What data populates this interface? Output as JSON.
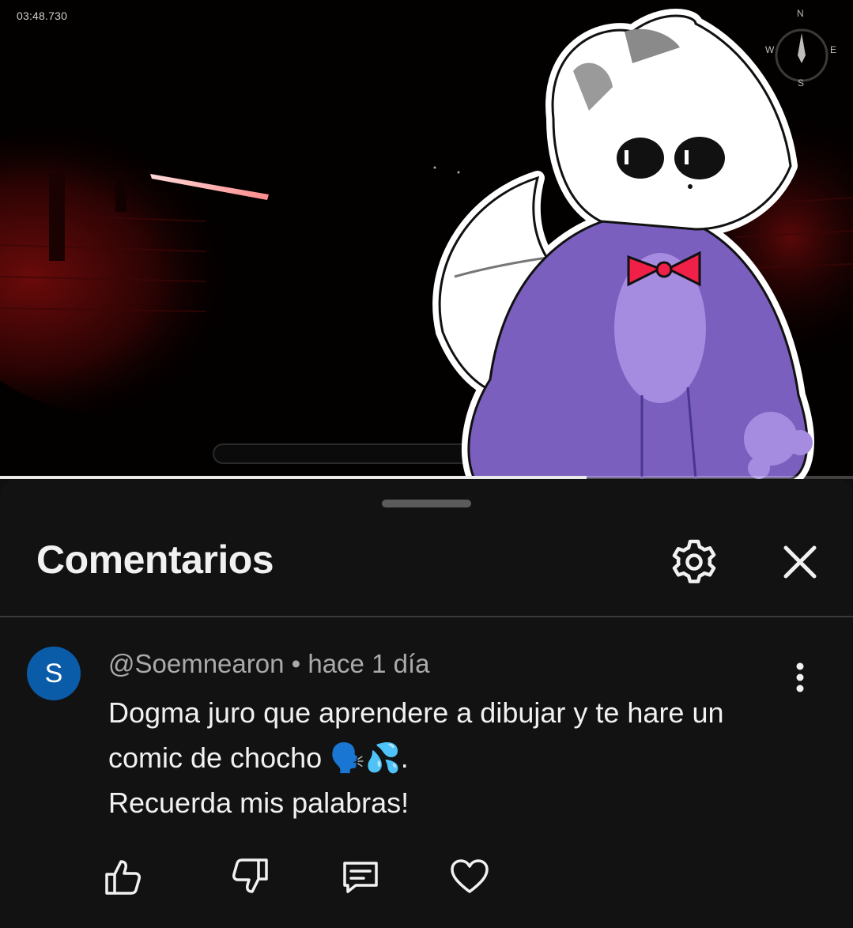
{
  "video": {
    "timestamp": "03:48.730",
    "progress_fraction": 0.688,
    "compass": {
      "n": "N",
      "s": "S",
      "w": "W",
      "e": "E"
    }
  },
  "comments_panel": {
    "title": "Comentarios",
    "settings_icon": "gear-icon",
    "close_icon": "close-icon"
  },
  "comment": {
    "avatar_letter": "S",
    "avatar_color": "#0b5ca8",
    "meta": "@Soemnearon • hace 1 día",
    "lines": [
      "Dogma juro que aprendere a dibujar y te hare un",
      "comic de chocho 🗣️💦.",
      "Recuerda mis palabras!"
    ],
    "actions": [
      "like-icon",
      "dislike-icon",
      "reply-icon",
      "heart-icon"
    ]
  }
}
